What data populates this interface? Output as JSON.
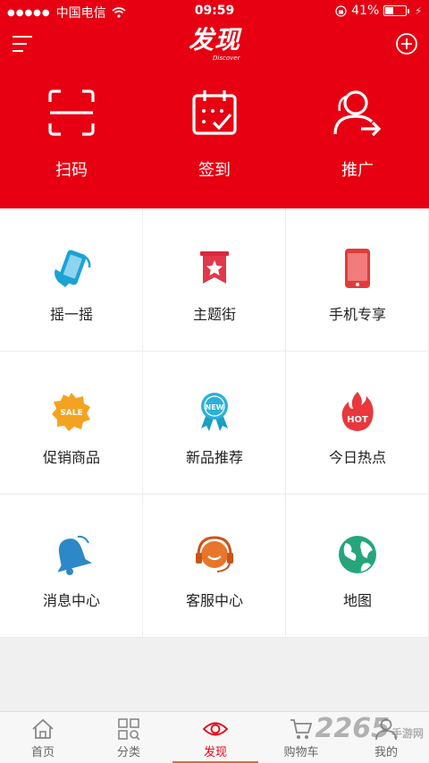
{
  "status_bar": {
    "carrier": "中国电信",
    "time": "09:59",
    "battery": "41%"
  },
  "header": {
    "logo": "发现",
    "logo_sub": "Discover",
    "accent_color": "#e60012"
  },
  "quick_actions": [
    {
      "label": "扫码",
      "icon": "scan-icon"
    },
    {
      "label": "签到",
      "icon": "calendar-check-icon"
    },
    {
      "label": "推广",
      "icon": "user-share-icon"
    }
  ],
  "grid": [
    {
      "label": "摇一摇",
      "icon": "shake-phone-icon"
    },
    {
      "label": "主题街",
      "icon": "star-banner-icon"
    },
    {
      "label": "手机专享",
      "icon": "mobile-icon"
    },
    {
      "label": "促销商品",
      "icon": "sale-badge-icon"
    },
    {
      "label": "新品推荐",
      "icon": "new-badge-icon"
    },
    {
      "label": "今日热点",
      "icon": "hot-flame-icon"
    },
    {
      "label": "消息中心",
      "icon": "bell-icon"
    },
    {
      "label": "客服中心",
      "icon": "headset-icon"
    },
    {
      "label": "地图",
      "icon": "globe-icon"
    }
  ],
  "tabbar": {
    "active_index": 2,
    "items": [
      {
        "label": "首页",
        "icon": "home-icon"
      },
      {
        "label": "分类",
        "icon": "category-icon"
      },
      {
        "label": "发现",
        "icon": "eye-icon"
      },
      {
        "label": "购物车",
        "icon": "cart-icon"
      },
      {
        "label": "我的",
        "icon": "user-icon"
      }
    ]
  },
  "watermark": {
    "number": "2265",
    "site": "手游网"
  }
}
